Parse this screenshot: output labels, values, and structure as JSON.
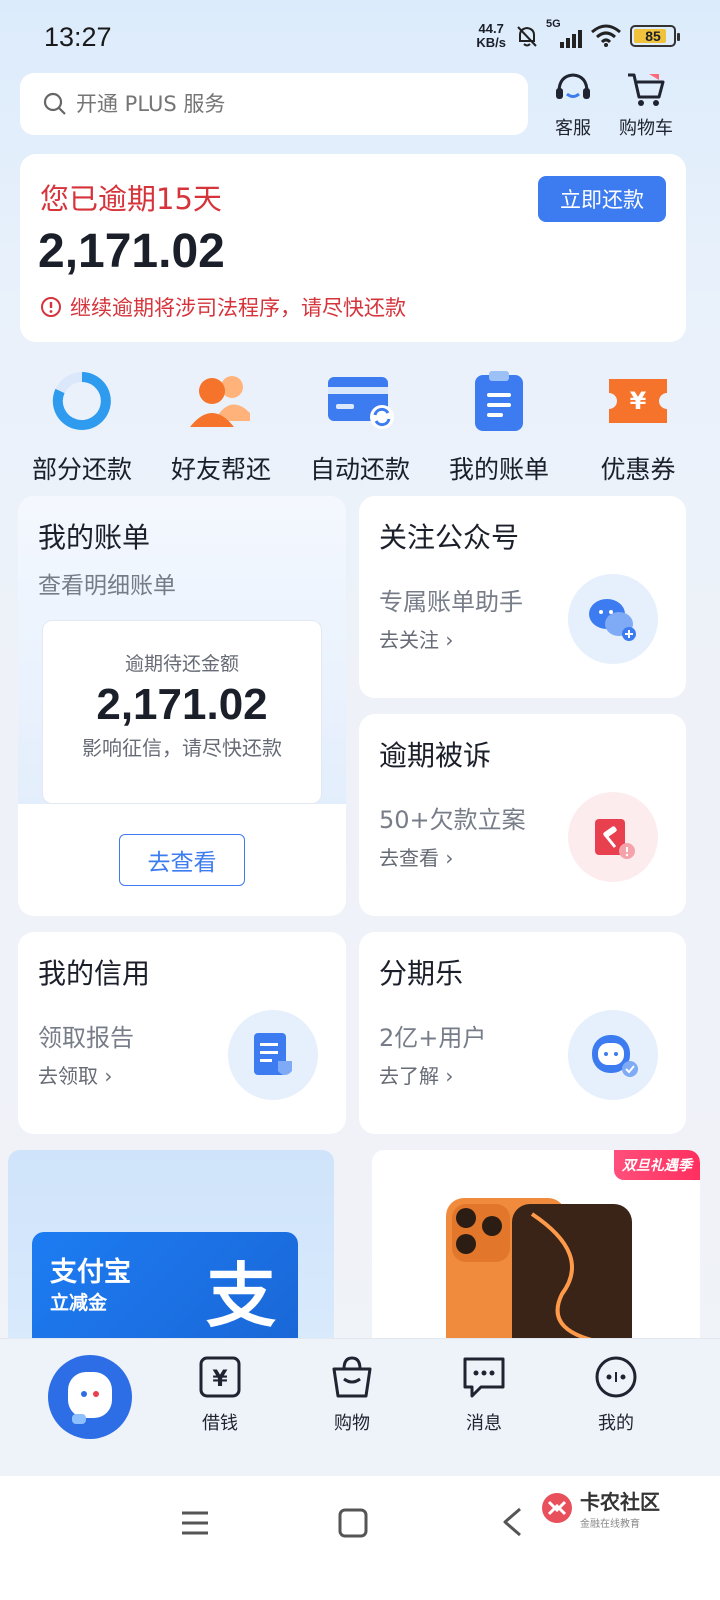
{
  "status_bar": {
    "time": "13:27",
    "net_speed_value": "44.7",
    "net_speed_unit": "KB/s",
    "network": "5G",
    "battery": "85",
    "battery_level": 0.85
  },
  "header": {
    "search_placeholder": "开通 PLUS 服务",
    "service_label": "客服",
    "cart_label": "购物车"
  },
  "overdue": {
    "title": "您已逾期15天",
    "amount": "2,171.02",
    "warning": "继续逾期将涉司法程序，请尽快还款",
    "repay_button": "立即还款"
  },
  "quick_actions": [
    {
      "label": "部分还款",
      "icon": "partial-repay-icon"
    },
    {
      "label": "好友帮还",
      "icon": "friends-help-icon"
    },
    {
      "label": "自动还款",
      "icon": "auto-repay-icon"
    },
    {
      "label": "我的账单",
      "icon": "bill-icon"
    },
    {
      "label": "优惠券",
      "icon": "coupon-icon"
    }
  ],
  "bill_card": {
    "title": "我的账单",
    "subtitle": "查看明细账单",
    "inner_label": "逾期待还金额",
    "inner_amount": "2,171.02",
    "inner_note": "影响征信，请尽快还款",
    "button": "去查看"
  },
  "tiles": {
    "wechat": {
      "title": "关注公众号",
      "subtitle": "专属账单助手",
      "link": "去关注 ›"
    },
    "sued": {
      "title": "逾期被诉",
      "subtitle": "50+欠款立案",
      "link": "去查看 ›"
    },
    "credit": {
      "title": "我的信用",
      "subtitle": "领取报告",
      "link": "去领取 ›"
    },
    "installment": {
      "title": "分期乐",
      "subtitle": "2亿+用户",
      "link": "去了解 ›"
    }
  },
  "banners": {
    "alipay_title": "支付宝",
    "alipay_sub": "立减金",
    "alipay_glyph": "支",
    "promo_badge": "双旦礼遇季"
  },
  "bottom_nav": [
    {
      "label": "借钱"
    },
    {
      "label": "购物"
    },
    {
      "label": "消息"
    },
    {
      "label": "我的"
    }
  ],
  "watermark": {
    "title": "卡农社区",
    "sub": "金融在线教育"
  },
  "colors": {
    "accent": "#3d7cf0",
    "danger": "#d6343b",
    "orange": "#f5732a"
  }
}
